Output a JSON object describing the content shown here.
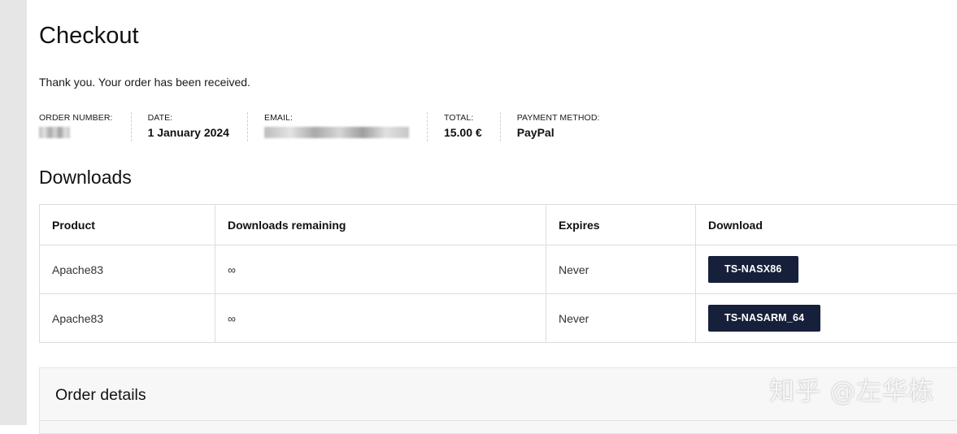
{
  "page": {
    "title": "Checkout",
    "thank_you": "Thank you. Your order has been received."
  },
  "order_overview": {
    "order_number_label": "ORDER NUMBER:",
    "date_label": "DATE:",
    "date_value": "1 January 2024",
    "email_label": "EMAIL:",
    "total_label": "TOTAL:",
    "total_value": "15.00 €",
    "payment_label": "PAYMENT METHOD:",
    "payment_value": "PayPal"
  },
  "downloads": {
    "title": "Downloads",
    "headers": [
      "Product",
      "Downloads remaining",
      "Expires",
      "Download"
    ],
    "rows": [
      {
        "product": "Apache83",
        "remaining": "∞",
        "expires": "Never",
        "button": "TS-NASX86"
      },
      {
        "product": "Apache83",
        "remaining": "∞",
        "expires": "Never",
        "button": "TS-NASARM_64"
      }
    ]
  },
  "order_details": {
    "title": "Order details"
  },
  "watermark": "知乎 @左华栋"
}
